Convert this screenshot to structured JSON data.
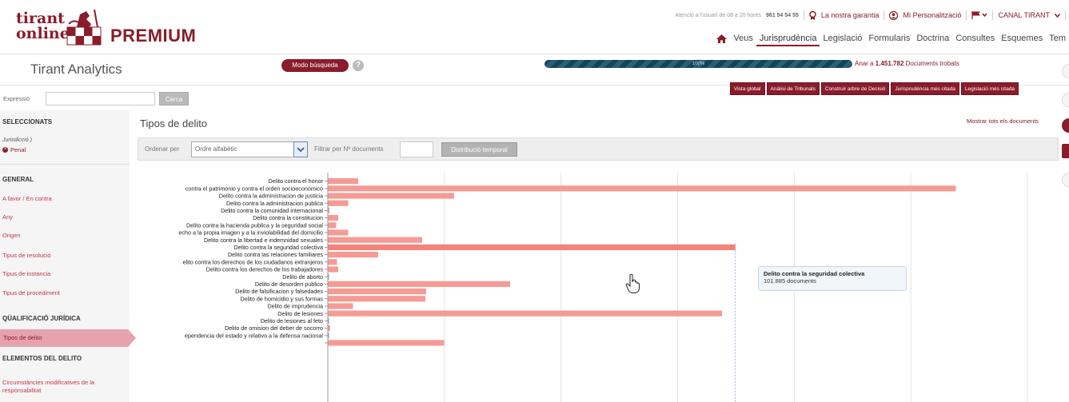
{
  "brand": {
    "logo_line1": "tirant",
    "logo_line2": "online",
    "edition": "PREMIUM",
    "accent_color": "#8a1c2b"
  },
  "topbar": {
    "service_text": "Atenció a l'usuari de 08 a 20 hores",
    "phone": "961 54 54 55",
    "guarantee_link": "La nostra garantia",
    "personalization_link": "Mi Personalització",
    "canal_link": "CANAL TIRANT"
  },
  "nav": {
    "items": [
      {
        "label": "Veus",
        "active": false
      },
      {
        "label": "Jurisprudència",
        "active": true
      },
      {
        "label": "Legislació",
        "active": false
      },
      {
        "label": "Formularis",
        "active": false
      },
      {
        "label": "Doctrina",
        "active": false
      },
      {
        "label": "Consultes",
        "active": false
      },
      {
        "label": "Esquemes",
        "active": false
      },
      {
        "label": "Tem",
        "active": false
      }
    ]
  },
  "analytics": {
    "title": "Tirant Analytics",
    "mode_button": "Modo búsqueda",
    "progress_label": "100%",
    "progress_value": 100,
    "found_prefix": "Anar a ",
    "found_count": "1.451.782",
    "found_suffix": " Documents trobats",
    "view_buttons": [
      "Vista global",
      "Anàlisi de Tribunals",
      "Construir arbre de Decisió",
      "Jurisprudència més citada",
      "Legislació més citada"
    ]
  },
  "search": {
    "label": "Expressió",
    "value": "",
    "button": "Cerca"
  },
  "sidebar": {
    "selected_heading": "SELECCIONATS",
    "selected_sub": "Jurisdicció )",
    "selected_value": "Penal",
    "general_heading": "GENERAL",
    "general_items": [
      "A favor / En contra",
      "Any",
      "Origen",
      "Tipus de resolució",
      "Tipus de instancia",
      "Tipus de procediment"
    ],
    "qual_heading": "QÜALIFICACIÓ JURÍDICA",
    "qual_items": [
      "Tipos de delito"
    ],
    "elements_heading": "ELEMENTOS DEL DELITO",
    "elements_items": [
      "Circumstàncies modificatives de la responsabilitat"
    ]
  },
  "main": {
    "title": "Tipos de delito",
    "show_all": "Mostrar tots els documents",
    "order_label": "Ordenar per",
    "order_value": "Ordre alfabètic",
    "filter_label": "Filtrar per Nº documents",
    "dist_button": "Distribució temporal"
  },
  "tooltip": {
    "title": "Delito contra la seguridad colectiva",
    "value": "101.885 documents"
  },
  "chart_data": {
    "type": "bar",
    "orientation": "horizontal",
    "categories": [
      "Delito contra el honor",
      "contra el patrimonio y contra el orden socioeconomico",
      "Delito contra la administracion de justicia",
      "Delito contra la administracion publica",
      "Delito contra la comunidad internacional",
      "Delito contra la constitucion",
      "Delito contra la hacienda publica y la seguridad social",
      "echo a la propia imagen y a la inviolabilidad del domicilio",
      "Delito contra la libertad e indemnidad sexuales",
      "Delito contra la seguridad colectiva",
      "Delito contra las relaciones familiares",
      "elito contra los derechos de los ciudadanos extranjeros",
      "Delito contra los derechos de los trabajadores",
      "Delito de aborto",
      "Delito de desorden publico",
      "Delito de falsificacion y falsedades",
      "Delito de homicidio y sus formas",
      "Delito de imprudencia",
      "Delito de lesiones",
      "Delito de lesiones al feto",
      "Delito de omision del deber de socorro",
      "ependencia del estado y relativo a la defensa nacional",
      ""
    ],
    "values": [
      7500,
      157000,
      31500,
      5000,
      300,
      2500,
      2000,
      5000,
      23500,
      101885,
      12500,
      2200,
      2500,
      200,
      45500,
      24500,
      24300,
      6200,
      98500,
      100,
      500,
      100,
      29000
    ],
    "xlim": [
      0,
      175000
    ],
    "grid": true,
    "bar_color": "#f59b94",
    "highlight_index": 9
  }
}
